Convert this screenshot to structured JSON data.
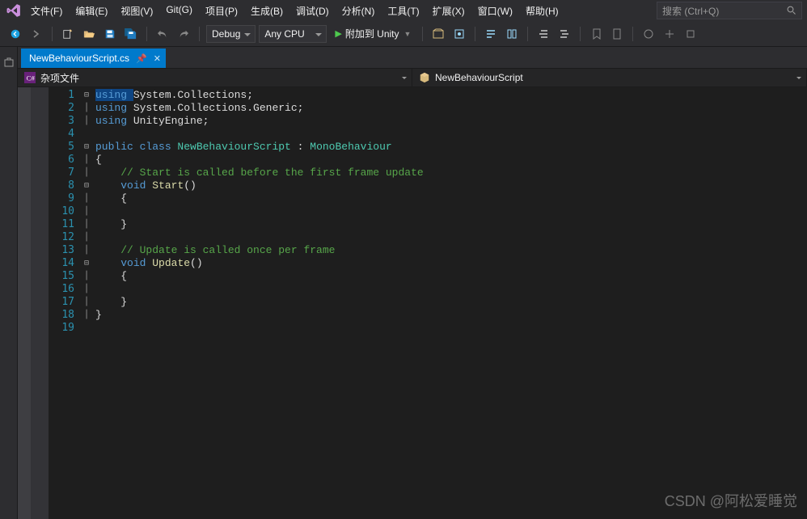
{
  "menubar": {
    "items": [
      "文件(F)",
      "编辑(E)",
      "视图(V)",
      "Git(G)",
      "项目(P)",
      "生成(B)",
      "调试(D)",
      "分析(N)",
      "工具(T)",
      "扩展(X)",
      "窗口(W)",
      "帮助(H)"
    ]
  },
  "search": {
    "placeholder": "搜索 (Ctrl+Q)"
  },
  "toolbar": {
    "config": "Debug",
    "platform": "Any CPU",
    "attach": "附加到 Unity"
  },
  "tab": {
    "filename": "NewBehaviourScript.cs"
  },
  "nav": {
    "left": "杂项文件",
    "right": "NewBehaviourScript"
  },
  "code": {
    "lines": [
      {
        "n": 1,
        "fold": "⊟",
        "ind": 0,
        "tokens": [
          {
            "t": "using ",
            "c": "kw hl"
          },
          {
            "t": "System.Collections",
            "c": ""
          },
          {
            "t": ";",
            "c": ""
          }
        ]
      },
      {
        "n": 2,
        "fold": "│",
        "ind": 0,
        "tokens": [
          {
            "t": "using ",
            "c": "kw"
          },
          {
            "t": "System.Collections.Generic",
            "c": ""
          },
          {
            "t": ";",
            "c": ""
          }
        ]
      },
      {
        "n": 3,
        "fold": "│",
        "ind": 0,
        "tokens": [
          {
            "t": "using ",
            "c": "kw"
          },
          {
            "t": "UnityEngine",
            "c": ""
          },
          {
            "t": ";",
            "c": ""
          }
        ]
      },
      {
        "n": 4,
        "fold": "",
        "ind": 0,
        "tokens": []
      },
      {
        "n": 5,
        "fold": "⊟",
        "ind": 0,
        "tokens": [
          {
            "t": "public class ",
            "c": "kw"
          },
          {
            "t": "NewBehaviourScript",
            "c": "cls"
          },
          {
            "t": " : ",
            "c": ""
          },
          {
            "t": "MonoBehaviour",
            "c": "cls"
          }
        ]
      },
      {
        "n": 6,
        "fold": "│",
        "ind": 0,
        "tokens": [
          {
            "t": "{",
            "c": ""
          }
        ]
      },
      {
        "n": 7,
        "fold": "│",
        "ind": 1,
        "tokens": [
          {
            "t": "// Start is called before the first frame update",
            "c": "cm"
          }
        ]
      },
      {
        "n": 8,
        "fold": "⊟",
        "ind": 1,
        "tokens": [
          {
            "t": "void ",
            "c": "kw"
          },
          {
            "t": "Start",
            "c": "mth"
          },
          {
            "t": "()",
            "c": ""
          }
        ]
      },
      {
        "n": 9,
        "fold": "│",
        "ind": 1,
        "tokens": [
          {
            "t": "{",
            "c": ""
          }
        ]
      },
      {
        "n": 10,
        "fold": "│",
        "ind": 2,
        "tokens": []
      },
      {
        "n": 11,
        "fold": "│",
        "ind": 1,
        "tokens": [
          {
            "t": "}",
            "c": ""
          }
        ]
      },
      {
        "n": 12,
        "fold": "│",
        "ind": 0,
        "tokens": []
      },
      {
        "n": 13,
        "fold": "│",
        "ind": 1,
        "tokens": [
          {
            "t": "// Update is called once per frame",
            "c": "cm"
          }
        ]
      },
      {
        "n": 14,
        "fold": "⊟",
        "ind": 1,
        "tokens": [
          {
            "t": "void ",
            "c": "kw"
          },
          {
            "t": "Update",
            "c": "mth"
          },
          {
            "t": "()",
            "c": ""
          }
        ]
      },
      {
        "n": 15,
        "fold": "│",
        "ind": 1,
        "tokens": [
          {
            "t": "{",
            "c": ""
          }
        ]
      },
      {
        "n": 16,
        "fold": "│",
        "ind": 2,
        "tokens": []
      },
      {
        "n": 17,
        "fold": "│",
        "ind": 1,
        "tokens": [
          {
            "t": "}",
            "c": ""
          }
        ]
      },
      {
        "n": 18,
        "fold": "│",
        "ind": 0,
        "tokens": [
          {
            "t": "}",
            "c": ""
          }
        ]
      },
      {
        "n": 19,
        "fold": "",
        "ind": 0,
        "tokens": []
      }
    ]
  },
  "watermark": "CSDN @阿松爱睡觉"
}
